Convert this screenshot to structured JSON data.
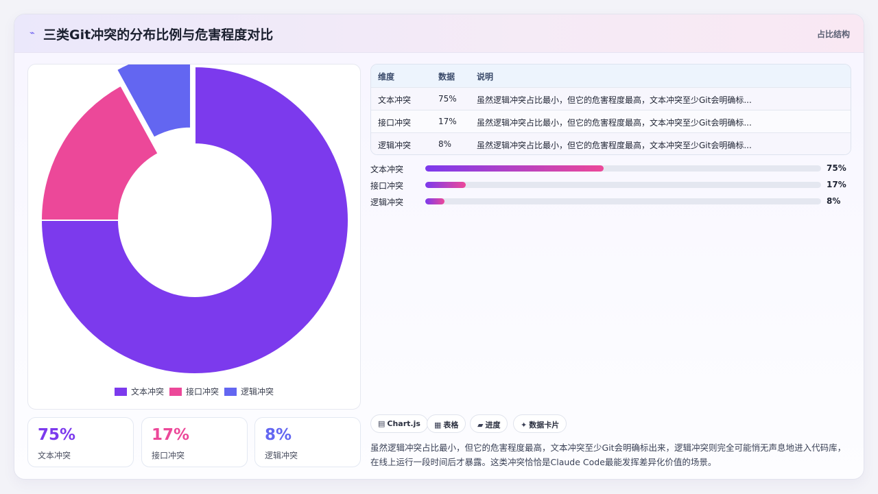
{
  "header": {
    "title": "三类Git冲突的分布比例与危害程度对比",
    "tag": "占比结构"
  },
  "colors": {
    "accent": "#7c3aed",
    "text": "#ec4899",
    "logic": "#6366f1"
  },
  "chart_data": {
    "type": "pie",
    "variant": "doughnut",
    "categories": [
      "文本冲突",
      "接口冲突",
      "逻辑冲突"
    ],
    "values": [
      75,
      17,
      8
    ],
    "colors": [
      "#7c3aed",
      "#ec4899",
      "#6366f1"
    ],
    "exploded": "逻辑冲突",
    "legend": "bottom"
  },
  "stats": [
    {
      "value": "75%",
      "label": "文本冲突",
      "color": "#7c3aed"
    },
    {
      "value": "17%",
      "label": "接口冲突",
      "color": "#ec4899"
    },
    {
      "value": "8%",
      "label": "逻辑冲突",
      "color": "#6366f1"
    }
  ],
  "table": {
    "headers": [
      "维度",
      "数据",
      "说明"
    ],
    "rows": [
      [
        "文本冲突",
        "75%",
        "虽然逻辑冲突占比最小，但它的危害程度最高，文本冲突至少Git会明确标..."
      ],
      [
        "接口冲突",
        "17%",
        "虽然逻辑冲突占比最小，但它的危害程度最高，文本冲突至少Git会明确标..."
      ],
      [
        "逻辑冲突",
        "8%",
        "虽然逻辑冲突占比最小，但它的危害程度最高，文本冲突至少Git会明确标..."
      ]
    ]
  },
  "progress": [
    {
      "label": "文本冲突",
      "pct_text": "75%",
      "fraction": 0.45
    },
    {
      "label": "接口冲突",
      "pct_text": "17%",
      "fraction": 0.102
    },
    {
      "label": "逻辑冲突",
      "pct_text": "8%",
      "fraction": 0.048
    }
  ],
  "chips": [
    {
      "icon": "▤",
      "icon_name": "chart-icon",
      "label": "Chart.js"
    },
    {
      "icon": "▦",
      "icon_name": "table-icon",
      "label": "表格"
    },
    {
      "icon": "▰",
      "icon_name": "progress-icon",
      "label": "进度"
    },
    {
      "icon": "✦",
      "icon_name": "sparkle-icon",
      "label": "数据卡片"
    }
  ],
  "description": "虽然逻辑冲突占比最小，但它的危害程度最高，文本冲突至少Git会明确标出来，逻辑冲突则完全可能悄无声息地进入代码库，在线上运行一段时间后才暴露。这类冲突恰恰是Claude Code最能发挥差异化价值的场景。"
}
